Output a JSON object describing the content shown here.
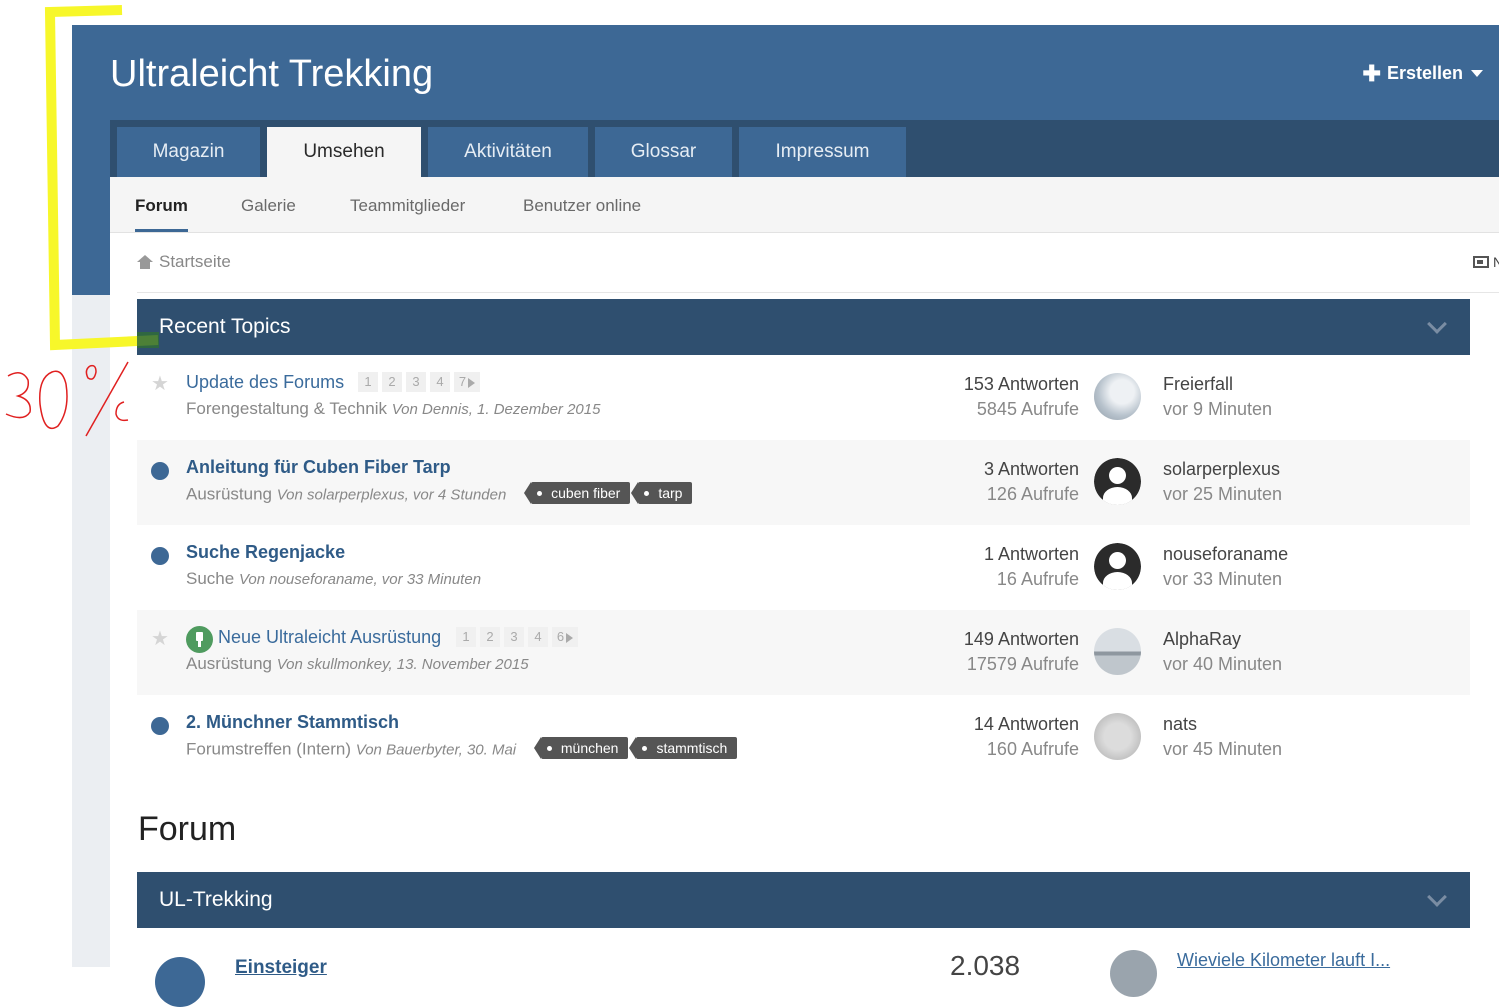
{
  "site": {
    "title": "Ultraleicht Trekking",
    "create_label": "Erstellen"
  },
  "nav": {
    "tabs": [
      {
        "label": "Magazin"
      },
      {
        "label": "Umsehen"
      },
      {
        "label": "Aktivitäten"
      },
      {
        "label": "Glossar"
      },
      {
        "label": "Impressum"
      }
    ]
  },
  "subnav": {
    "items": [
      {
        "label": "Forum"
      },
      {
        "label": "Galerie"
      },
      {
        "label": "Teammitglieder"
      },
      {
        "label": "Benutzer online"
      }
    ]
  },
  "breadcrumb": {
    "home": "Startseite"
  },
  "recent_topics": {
    "heading": "Recent Topics",
    "topics": [
      {
        "title": "Update des Forums",
        "pages": [
          "1",
          "2",
          "3",
          "4",
          "7"
        ],
        "forum": "Forengestaltung & Technik",
        "by": "Von Dennis, 1. Dezember 2015",
        "replies": "153 Antworten",
        "views": "5845 Aufrufe",
        "last_user": "Freierfall",
        "last_time": "vor 9 Minuten",
        "tags": []
      },
      {
        "title": "Anleitung für Cuben Fiber Tarp",
        "forum": "Ausrüstung",
        "by": "Von solarperplexus, vor 4 Stunden",
        "replies": "3 Antworten",
        "views": "126 Aufrufe",
        "last_user": "solarperplexus",
        "last_time": "vor 25 Minuten",
        "tags": [
          "cuben fiber",
          "tarp"
        ]
      },
      {
        "title": "Suche Regenjacke",
        "forum": "Suche",
        "by": "Von nouseforaname, vor 33 Minuten",
        "replies": "1 Antworten",
        "views": "16 Aufrufe",
        "last_user": "nouseforaname",
        "last_time": "vor 33 Minuten",
        "tags": []
      },
      {
        "title": "Neue Ultraleicht Ausrüstung",
        "pages": [
          "1",
          "2",
          "3",
          "4",
          "6"
        ],
        "forum": "Ausrüstung",
        "by": "Von skullmonkey, 13. November 2015",
        "replies": "149 Antworten",
        "views": "17579 Aufrufe",
        "last_user": "AlphaRay",
        "last_time": "vor 40 Minuten",
        "tags": []
      },
      {
        "title": "2. Münchner Stammtisch",
        "forum": "Forumstreffen (Intern)",
        "by": "Von Bauerbyter, 30. Mai",
        "replies": "14 Antworten",
        "views": "160 Aufrufe",
        "last_user": "nats",
        "last_time": "vor 45 Minuten",
        "tags": [
          "münchen",
          "stammtisch"
        ]
      }
    ]
  },
  "forum": {
    "heading": "Forum",
    "category": "UL-Trekking",
    "first_forum": {
      "title": "Einsteiger",
      "count": "2.038",
      "last_post": "Wieviele Kilometer lauft I..."
    }
  },
  "annotation": {
    "text": "30%",
    "bracket_color": "#f7f72a",
    "ink_color": "#e02020"
  },
  "colors": {
    "header": "#3d6895",
    "nav_dark": "#2f4f6f",
    "link": "#3a6b9c"
  }
}
